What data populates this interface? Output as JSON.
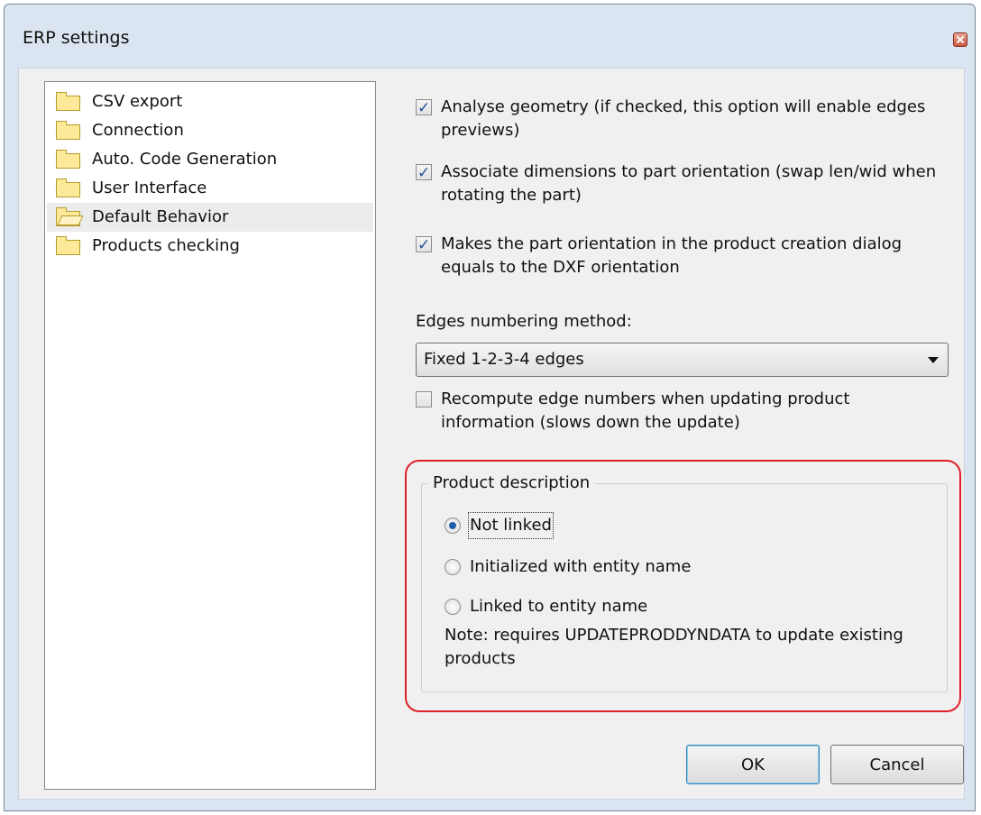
{
  "window": {
    "title": "ERP settings"
  },
  "sidebar": {
    "items": [
      {
        "label": "CSV export"
      },
      {
        "label": "Connection"
      },
      {
        "label": "Auto. Code Generation"
      },
      {
        "label": "User Interface"
      },
      {
        "label": "Default Behavior"
      },
      {
        "label": "Products checking"
      }
    ]
  },
  "options": {
    "analyse_geometry": "Analyse geometry (if checked, this option will enable edges previews)",
    "associate_dimensions": "Associate dimensions to part orientation (swap len/wid when rotating the part)",
    "part_orientation": "Makes the part orientation in the product creation dialog equals to the DXF orientation",
    "recompute_edges": "Recompute edge numbers when updating product information (slows down the update)"
  },
  "edges": {
    "label": "Edges numbering method:",
    "selected": "Fixed 1-2-3-4 edges"
  },
  "product_description": {
    "title": "Product description",
    "options": [
      {
        "label": "Not linked"
      },
      {
        "label": "Initialized with entity name"
      },
      {
        "label": "Linked to entity name"
      }
    ],
    "note": "Note: requires UPDATEPRODDYNDATA to update existing products"
  },
  "buttons": {
    "ok": "OK",
    "cancel": "Cancel"
  }
}
